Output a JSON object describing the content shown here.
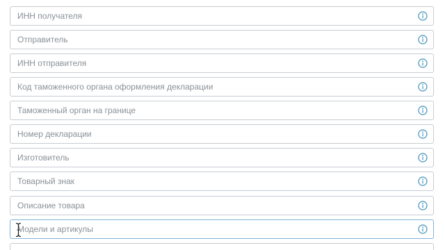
{
  "form": {
    "fields": [
      {
        "label": "ИНН получателя"
      },
      {
        "label": "Отправитель"
      },
      {
        "label": "ИНН отправителя"
      },
      {
        "label": "Код таможенного органа оформления декларации"
      },
      {
        "label": "Таможенный орган на границе"
      },
      {
        "label": "Номер декларации"
      },
      {
        "label": "Изготовитель"
      },
      {
        "label": "Товарный знак"
      },
      {
        "label": "Описание товара"
      },
      {
        "label": "Модели и артикулы"
      },
      {
        "label": ""
      }
    ],
    "active_field_index": 9
  },
  "icons": {
    "info": "info-circle-icon",
    "cursor": "text-cursor-icon"
  },
  "colors": {
    "border": "#c6ccd2",
    "active_border": "#7fb2d8",
    "placeholder_text": "#8a9096",
    "info_icon": "#3f8fb6"
  }
}
